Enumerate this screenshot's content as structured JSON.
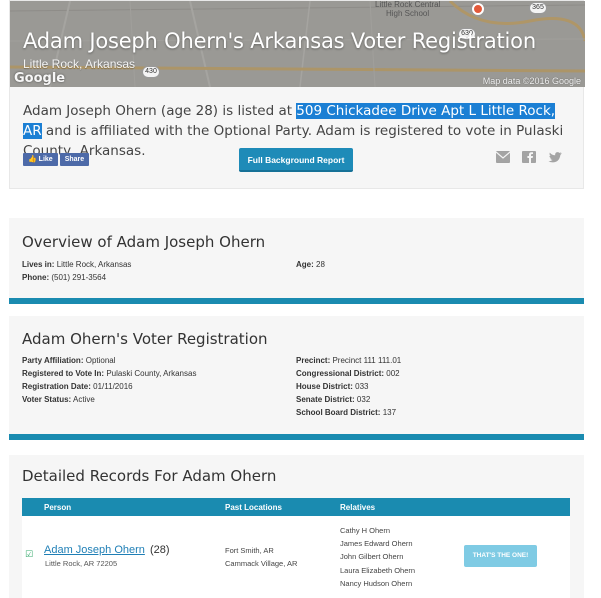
{
  "header": {
    "title": "Adam Joseph Ohern's Arkansas Voter Registration",
    "subtitle": "Little Rock, Arkansas",
    "map_brand": "Google",
    "map_credit": "Map data ©2016 Google",
    "map_labels": [
      "Little Rock Central",
      "High School"
    ],
    "map_highways": [
      "365",
      "630",
      "430"
    ],
    "summary_before": "Adam Joseph Ohern (age 28) is listed at ",
    "summary_address": "509 Chickadee Drive Apt L Little Rock, AR",
    "summary_after": " and is affiliated with the Optional Party. Adam is registered to vote in Pulaski County, Arkansas.",
    "like_label": "Like",
    "share_label": "Share",
    "background_button": "Full Background Report",
    "share_icons": [
      "mail-icon",
      "facebook-icon",
      "twitter-icon"
    ]
  },
  "overview": {
    "title": "Overview of Adam Joseph Ohern",
    "lives_in_label": "Lives in:",
    "lives_in_value": "Little Rock, Arkansas",
    "phone_label": "Phone:",
    "phone_value": "(501) 291-3564",
    "age_label": "Age:",
    "age_value": "28"
  },
  "voter": {
    "title": "Adam Ohern's Voter Registration",
    "left": [
      {
        "label": "Party Affiliation:",
        "value": "Optional"
      },
      {
        "label": "Registered to Vote In:",
        "value": "Pulaski County, Arkansas"
      },
      {
        "label": "Registration Date:",
        "value": "01/11/2016"
      },
      {
        "label": "Voter Status:",
        "value": "Active"
      }
    ],
    "right": [
      {
        "label": "Precinct:",
        "value": "Precinct 111 111.01"
      },
      {
        "label": "Congressional District:",
        "value": "002"
      },
      {
        "label": "House District:",
        "value": "033"
      },
      {
        "label": "Senate District:",
        "value": "032"
      },
      {
        "label": "School Board District:",
        "value": "137"
      }
    ]
  },
  "records": {
    "title": "Detailed Records For Adam Ohern",
    "columns": [
      "Person",
      "Past Locations",
      "Relatives"
    ],
    "row": {
      "name": "Adam Joseph Ohern",
      "age": "(28)",
      "location": "Little Rock, AR 72205",
      "past_locations": [
        "Fort Smith, AR",
        "Cammack Village, AR"
      ],
      "relatives": [
        "Cathy H Ohern",
        "James Edward Ohern",
        "John Gilbert Ohern",
        "Laura Elizabeth Ohern",
        "Nancy Hudson Ohern"
      ],
      "button": "THAT'S THE ONE!"
    }
  },
  "colors": {
    "accent": "#1a8bb0",
    "highlight": "#1b7fd4",
    "link": "#1f7fb6",
    "button_light": "#7fcbe4"
  }
}
